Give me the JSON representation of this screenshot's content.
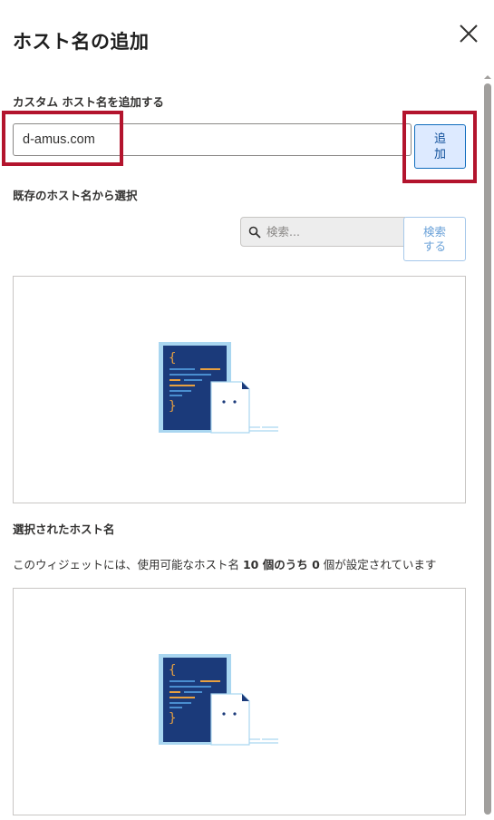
{
  "dialog": {
    "title": "ホスト名の追加",
    "close_label": "閉じる"
  },
  "custom": {
    "label": "カスタム ホスト名を追加する",
    "input_value": "d-amus.com",
    "add_button": "追\n加"
  },
  "existing": {
    "label": "既存のホスト名から選択",
    "search_placeholder": "検索...",
    "search_button": "検索\nする"
  },
  "selected": {
    "label": "選択されたホスト名",
    "desc_prefix": "このウィジェットには、使用可能なホスト名 ",
    "total": "10",
    "desc_mid": " 個のうち ",
    "count": "0",
    "desc_suffix": " 個が設定されています"
  },
  "icons": {
    "close": "close-icon",
    "search": "search-icon",
    "empty_state": "code-document-icon"
  },
  "colors": {
    "highlight": "#b3142d",
    "accent": "#0f6cbd",
    "code_bg": "#1b3a7a",
    "code_frame": "#a9d6f0"
  }
}
